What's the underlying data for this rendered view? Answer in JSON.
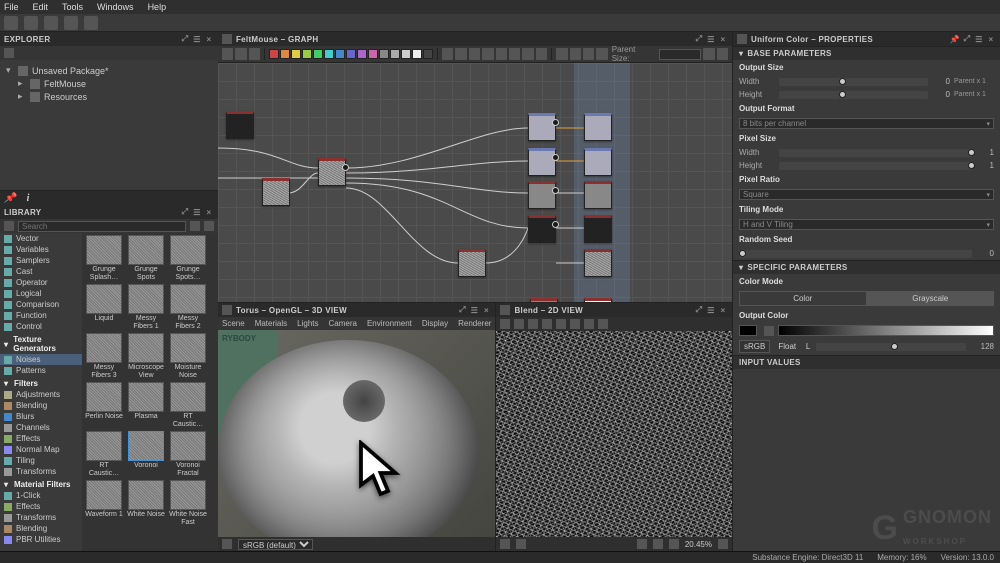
{
  "menubar": [
    "File",
    "Edit",
    "Tools",
    "Windows",
    "Help"
  ],
  "explorer": {
    "title": "EXPLORER",
    "items": [
      {
        "label": "Unsaved Package*",
        "expanded": true
      },
      {
        "label": "FeltMouse",
        "indent": true,
        "expanded": true
      },
      {
        "label": "Resources",
        "indent": true,
        "expanded": true
      }
    ]
  },
  "library": {
    "title": "LIBRARY",
    "search_placeholder": "Search",
    "category_groups": [
      {
        "label": "",
        "cats": [
          {
            "label": "Vector",
            "ico": "#6aa",
            "sel": false
          },
          {
            "label": "Variables",
            "ico": "#6aa"
          },
          {
            "label": "Samplers",
            "ico": "#6aa"
          },
          {
            "label": "Cast",
            "ico": "#6aa"
          },
          {
            "label": "Operator",
            "ico": "#6aa"
          },
          {
            "label": "Logical",
            "ico": "#6aa"
          },
          {
            "label": "Comparison",
            "ico": "#6aa"
          },
          {
            "label": "Function",
            "ico": "#6aa"
          },
          {
            "label": "Control",
            "ico": "#6aa"
          }
        ]
      },
      {
        "label": "Texture Generators",
        "cats": [
          {
            "label": "Noises",
            "ico": "#6aa",
            "sel": true
          },
          {
            "label": "Patterns",
            "ico": "#6aa"
          }
        ]
      },
      {
        "label": "Filters",
        "cats": [
          {
            "label": "Adjustments",
            "ico": "#aa8"
          },
          {
            "label": "Blending",
            "ico": "#a86"
          },
          {
            "label": "Blurs",
            "ico": "#48c"
          },
          {
            "label": "Channels",
            "ico": "#999"
          },
          {
            "label": "Effects",
            "ico": "#8a6"
          },
          {
            "label": "Normal Map",
            "ico": "#88e"
          },
          {
            "label": "Tiling",
            "ico": "#6aa"
          },
          {
            "label": "Transforms",
            "ico": "#999"
          }
        ]
      },
      {
        "label": "Material Filters",
        "cats": [
          {
            "label": "1-Click",
            "ico": "#6aa"
          },
          {
            "label": "Effects",
            "ico": "#8a6"
          },
          {
            "label": "Transforms",
            "ico": "#999"
          },
          {
            "label": "Blending",
            "ico": "#a86"
          },
          {
            "label": "PBR Utilities",
            "ico": "#88e"
          }
        ]
      }
    ],
    "thumbs": [
      "Grunge Splash…",
      "Grunge Spots",
      "Grunge Spots…",
      "Liquid",
      "Messy Fibers 1",
      "Messy Fibers 2",
      "Messy Fibers 3",
      "Microscope View",
      "Moisture Noise",
      "Perlin Noise",
      "Plasma",
      "RT Caustic…",
      "RT Caustic…",
      "Voronoi",
      "Voronoi Fractal",
      "Waveform 1",
      "White Noise",
      "White Noise Fast"
    ],
    "selected_thumb": 13
  },
  "graph": {
    "title": "FeltMouse – GRAPH",
    "parent_label": "Parent Size:",
    "parent_value": "",
    "swatch_colors": [
      "#c44",
      "#d84",
      "#dc4",
      "#9c4",
      "#4c6",
      "#4cc",
      "#48c",
      "#66c",
      "#a6c",
      "#c6a",
      "#888",
      "#aaa",
      "#ccc",
      "#eee",
      "#444"
    ]
  },
  "view3d": {
    "title": "Torus – OpenGL – 3D VIEW",
    "menus": [
      "Scene",
      "Materials",
      "Lights",
      "Camera",
      "Environment",
      "Display",
      "Renderer"
    ],
    "status_dd": "sRGB (default)"
  },
  "view2d": {
    "title": "Blend – 2D VIEW",
    "zoom": "20.45%"
  },
  "properties": {
    "title": "Uniform Color – PROPERTIES",
    "sections": {
      "base": "BASE PARAMETERS",
      "specific": "SPECIFIC PARAMETERS",
      "input": "INPUT VALUES"
    },
    "output_size": {
      "label": "Output Size",
      "width_label": "Width",
      "height_label": "Height",
      "width": 0,
      "height": 0,
      "mode": "Parent x 1"
    },
    "output_format": {
      "label": "Output Format",
      "value": "8 bits per channel"
    },
    "pixel_size": {
      "label": "Pixel Size",
      "width_label": "Width",
      "height_label": "Height",
      "width": 1,
      "height": 1
    },
    "pixel_ratio": {
      "label": "Pixel Ratio",
      "value": "Square"
    },
    "tiling_mode": {
      "label": "Tiling Mode",
      "value": "H and V Tiling"
    },
    "random_seed": {
      "label": "Random Seed",
      "value": 0
    },
    "color_mode": {
      "label": "Color Mode",
      "opt_color": "Color",
      "opt_gray": "Grayscale"
    },
    "output_color": {
      "label": "Output Color",
      "srgb": "sRGB",
      "float": "Float",
      "value": 128,
      "slider_label": "L"
    }
  },
  "statusbar": {
    "engine": "Substance Engine: Direct3D 11",
    "memory": "Memory: 16%",
    "version": "Version: 13.0.0"
  }
}
